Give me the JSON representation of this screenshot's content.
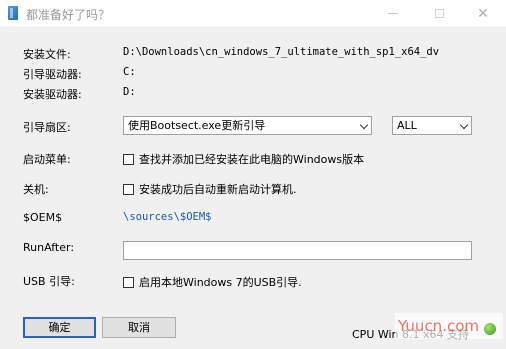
{
  "window": {
    "title": "都准备好了吗？",
    "minimize_glyph": "minimize-icon",
    "maximize_glyph": "maximize-icon",
    "close_glyph": "✕"
  },
  "info": {
    "install_file_label": "安装文件:",
    "install_file_value": "D:\\Downloads\\cn_windows_7_ultimate_with_sp1_x64_dv",
    "boot_drive_label": "引导驱动器:",
    "boot_drive_value": "C:",
    "install_drive_label": "安装驱动器:",
    "install_drive_value": "D:"
  },
  "boot_sector": {
    "label": "引导扇区:",
    "selected": "使用Bootsect.exe更新引导",
    "secondary_selected": "ALL"
  },
  "boot_menu": {
    "label": "启动菜单:",
    "checkbox_label": "查找并添加已经安装在此电脑的Windows版本",
    "checked": false
  },
  "shutdown": {
    "label": "关机:",
    "checkbox_label": "安装成功后自动重新启动计算机.",
    "checked": false
  },
  "oem": {
    "label": "$OEM$",
    "value": "\\sources\\$OEM$"
  },
  "run_after": {
    "label": "RunAfter:",
    "value": "",
    "placeholder": ""
  },
  "usb": {
    "label": "USB 引导:",
    "checkbox_label": "启用本地Windows 7的USB引导.",
    "checked": false
  },
  "buttons": {
    "ok": "确定",
    "cancel": "取消"
  },
  "status": {
    "text": "CPU Win 8.1 x64 支持",
    "watermark": "Yuucn.com",
    "indicator_color": "#3a9a20"
  },
  "colors": {
    "accent": "#2a62c4",
    "link_blue": "#1a5aa8"
  }
}
